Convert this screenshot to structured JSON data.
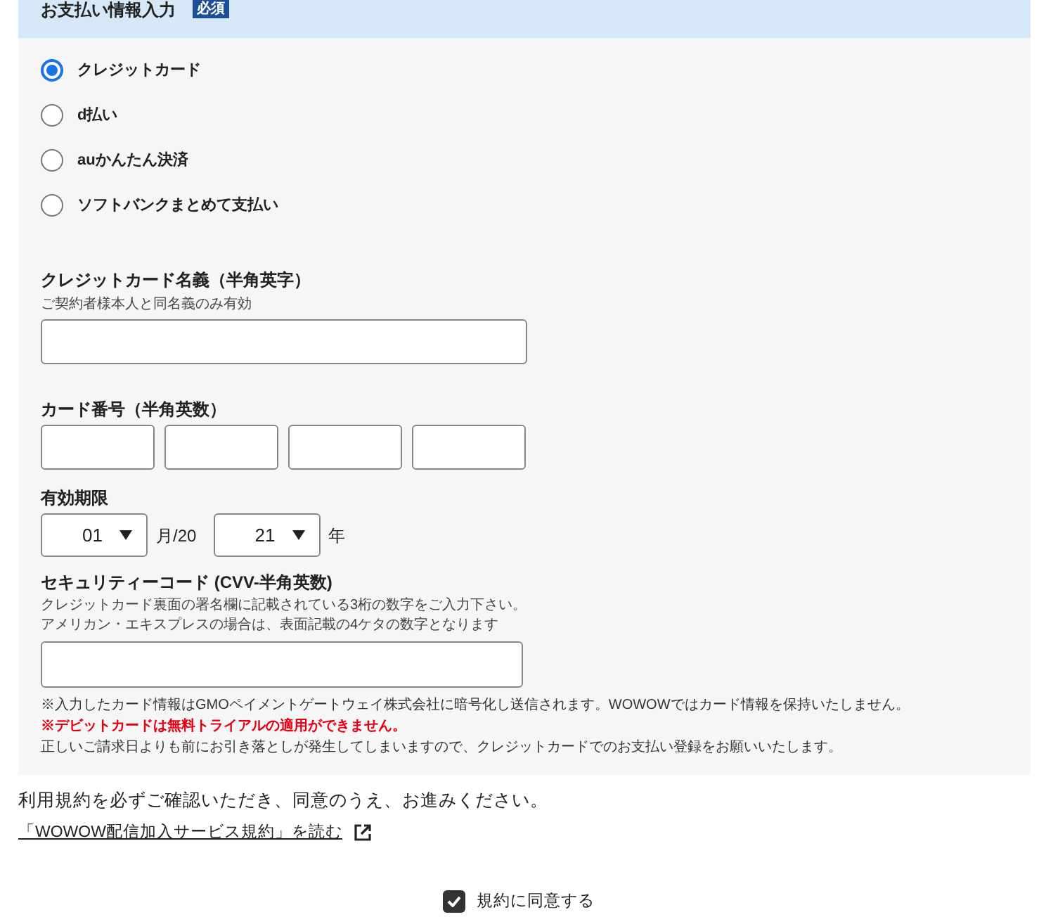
{
  "section": {
    "title": "お支払い情報入力",
    "badge": "必須"
  },
  "payment_methods": [
    {
      "label": "クレジットカード",
      "selected": true
    },
    {
      "label": "d払い",
      "selected": false
    },
    {
      "label": "auかんたん決済",
      "selected": false
    },
    {
      "label": "ソフトバンクまとめて支払い",
      "selected": false
    }
  ],
  "card_name": {
    "label": "クレジットカード名義（半角英字）",
    "hint": "ご契約者様本人と同名義のみ有効"
  },
  "card_number": {
    "label": "カード番号（半角英数）"
  },
  "expiry": {
    "label": "有効期限",
    "month": "01",
    "month_suffix": "月/20",
    "year": "21",
    "year_suffix": "年"
  },
  "security_code": {
    "label": "セキュリティーコード (CVV-半角英数)",
    "hints": [
      "クレジットカード裏面の署名欄に記載されている3桁の数字をご入力下さい。",
      "アメリカン・エキスプレスの場合は、表面記載の4ケタの数字となります"
    ]
  },
  "notes": [
    {
      "kind": "normal",
      "text": "※入力したカード情報はGMOペイメントゲートウェイ株式会社に暗号化し送信されます。WOWOWではカード情報を保持いたしません。"
    },
    {
      "kind": "warning",
      "text": "※デビットカードは無料トライアルの適用ができません。"
    },
    {
      "kind": "normal",
      "text": "正しいご請求日よりも前にお引き落としが発生してしまいますので、クレジットカードでのお支払い登録をお願いいたします。"
    }
  ],
  "terms": {
    "text": "利用規約を必ずご確認いただき、同意のうえ、お進みください。",
    "link": "「WOWOW配信加入サービス規約」を読む"
  },
  "agree": {
    "label": "規約に同意する",
    "checked": true
  }
}
